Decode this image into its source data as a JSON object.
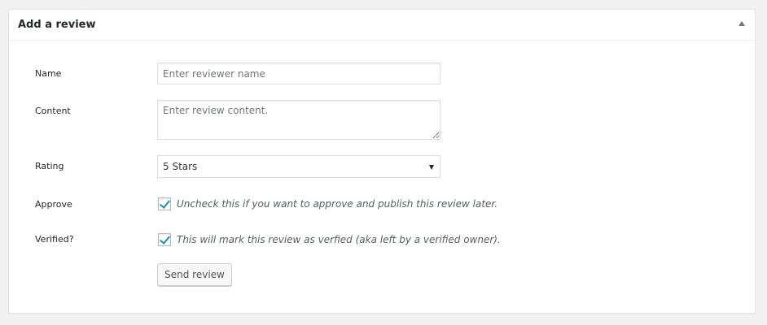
{
  "panel": {
    "title": "Add a review"
  },
  "form": {
    "name": {
      "label": "Name",
      "placeholder": "Enter reviewer name",
      "value": ""
    },
    "content": {
      "label": "Content",
      "placeholder": "Enter review content.",
      "value": ""
    },
    "rating": {
      "label": "Rating",
      "selected": "5 Stars"
    },
    "approve": {
      "label": "Approve",
      "checked": true,
      "description": "Uncheck this if you want to approve and publish this review later."
    },
    "verified": {
      "label": "Verified?",
      "checked": true,
      "description": "This will mark this review as verfied (aka left by a verified owner)."
    },
    "submit_label": "Send review"
  },
  "colors": {
    "accent": "#1e8cbe",
    "panel_bg": "#ffffff",
    "page_bg": "#f1f1f1"
  }
}
